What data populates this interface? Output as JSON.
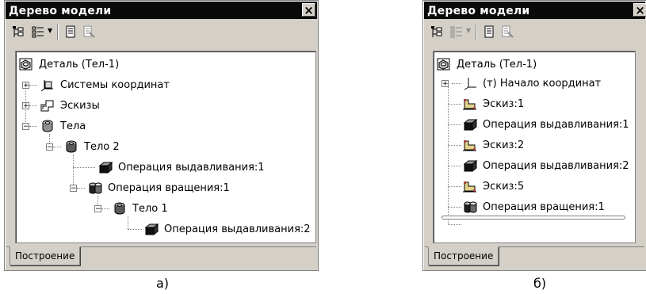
{
  "panel_a": {
    "title": "Дерево модели",
    "close_label": "×",
    "tab_label": "Построение",
    "caption": "а)",
    "nodes": [
      {
        "label": "Деталь (Тел-1)",
        "icon": "part-icon"
      },
      {
        "label": "Системы координат",
        "icon": "coordinate-system-icon"
      },
      {
        "label": "Эскизы",
        "icon": "sketches-icon"
      },
      {
        "label": "Тела",
        "icon": "bodies-icon"
      },
      {
        "label": "Тело 2",
        "icon": "body-icon"
      },
      {
        "label": "Операция выдавливания:1",
        "icon": "extrusion-icon"
      },
      {
        "label": "Операция вращения:1",
        "icon": "revolve-icon"
      },
      {
        "label": "Тело 1",
        "icon": "body-icon"
      },
      {
        "label": "Операция выдавливания:2",
        "icon": "extrusion-icon"
      }
    ]
  },
  "panel_b": {
    "title": "Дерево модели",
    "close_label": "×",
    "tab_label": "Построение",
    "caption": "б)",
    "nodes": [
      {
        "label": "Деталь (Тел-1)",
        "icon": "part-icon"
      },
      {
        "label": "(т) Начало координат",
        "icon": "origin-icon"
      },
      {
        "label": "Эскиз:1",
        "icon": "sketch-icon"
      },
      {
        "label": "Операция выдавливания:1",
        "icon": "extrusion-icon"
      },
      {
        "label": "Эскиз:2",
        "icon": "sketch-icon"
      },
      {
        "label": "Операция выдавливания:2",
        "icon": "extrusion-icon"
      },
      {
        "label": "Эскиз:5",
        "icon": "sketch-icon"
      },
      {
        "label": "Операция вращения:1",
        "icon": "revolve-icon"
      }
    ]
  }
}
